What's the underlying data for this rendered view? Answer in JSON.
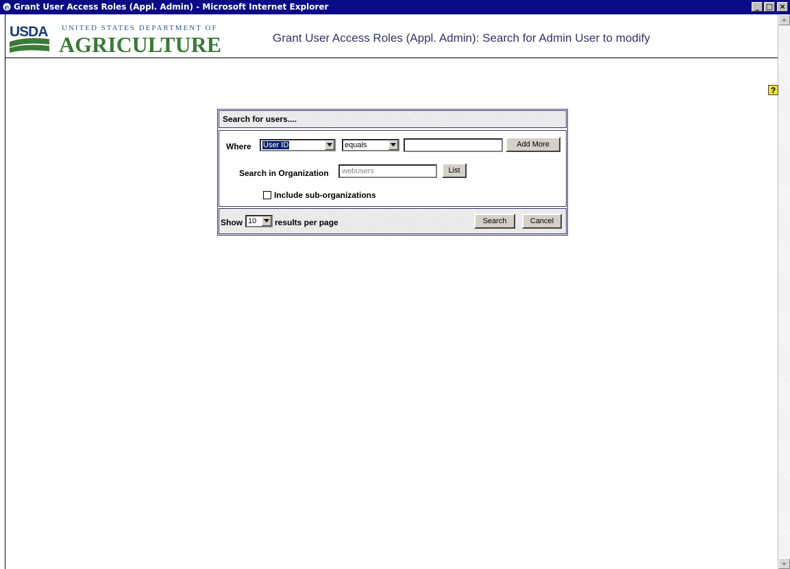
{
  "window": {
    "title": "Grant User Access Roles (Appl. Admin) - Microsoft Internet Explorer",
    "minimize": "_",
    "maximize": "□",
    "close": "×"
  },
  "header": {
    "logo_usda": "USDA",
    "logo_dept": "UNITED STATES DEPARTMENT OF",
    "logo_word": "AGRICULTURE",
    "title": "Grant User Access Roles (Appl. Admin): Search for Admin User to modify"
  },
  "form": {
    "heading": "Search for users....",
    "where_label": "Where",
    "attribute_select": "User ID",
    "operator_select": "equals",
    "value_input": "",
    "add_more_button": "Add More",
    "org_label": "Search in Organization",
    "org_input": "webusers",
    "list_button": "List",
    "include_sub_label": "Include sub-organizations",
    "include_sub_checked": false,
    "show_label": "Show",
    "per_page_select": "10",
    "per_page_label": "results per page",
    "search_button": "Search",
    "cancel_button": "Cancel"
  },
  "icons": {
    "browser": "ie-icon",
    "help": "help-icon",
    "scroll_up": "scroll-up-icon",
    "scroll_down": "scroll-down-icon"
  },
  "colors": {
    "titlebar": "#0a0a86",
    "header_title": "#333366",
    "form_border": "#333366",
    "usda_green": "#3a7a3a"
  }
}
